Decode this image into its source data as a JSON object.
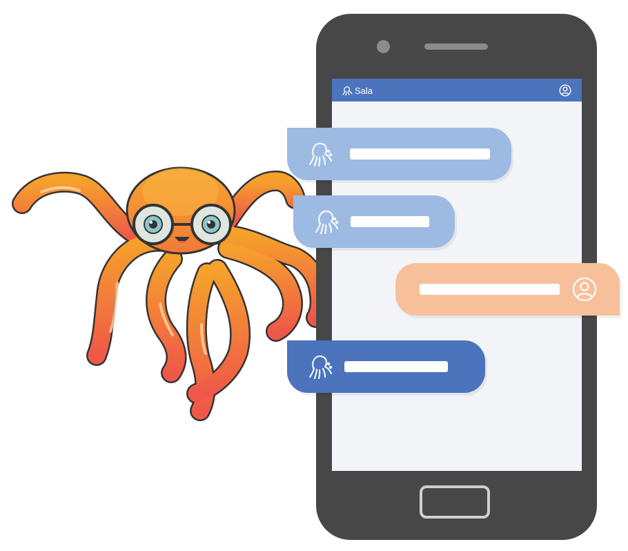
{
  "app": {
    "name": "Sala",
    "logo_icon": "octopus-logo-icon",
    "profile_icon": "user-circle-icon"
  },
  "colors": {
    "phone_body": "#474747",
    "screen_bg": "#f2f4f7",
    "app_bar": "#4b74bd",
    "bot_bubble_light": "#9dbbe2",
    "bot_bubble_dark": "#4b74bd",
    "user_bubble": "#f7c09a",
    "octopus_orange": "#f5a12c",
    "octopus_red": "#f05a4a"
  },
  "messages": [
    {
      "sender": "bot",
      "icon": "octopus-bot-icon"
    },
    {
      "sender": "bot",
      "icon": "octopus-bot-icon"
    },
    {
      "sender": "user",
      "icon": "user-circle-icon"
    },
    {
      "sender": "bot",
      "icon": "octopus-bot-icon"
    }
  ]
}
